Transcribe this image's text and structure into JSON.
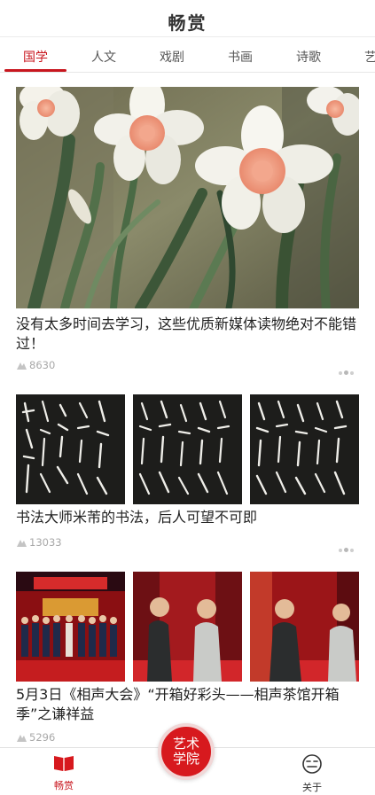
{
  "header": {
    "title": "畅赏"
  },
  "tabs": [
    {
      "label": "国学",
      "active": true
    },
    {
      "label": "人文",
      "active": false
    },
    {
      "label": "戏剧",
      "active": false
    },
    {
      "label": "书画",
      "active": false
    },
    {
      "label": "诗歌",
      "active": false
    },
    {
      "label": "艺",
      "active": false
    }
  ],
  "feed": {
    "articles": [
      {
        "title": "没有太多时间去学习，这些优质新媒体读物绝对不能错过！",
        "views": "8630",
        "image": "daffodil-painting"
      },
      {
        "title": "书法大师米芾的书法，后人可望不可即",
        "views": "13033",
        "image": "calligraphy-panels"
      },
      {
        "title": "5月3日《相声大会》“开箱好彩头——相声茶馆开箱季”之谦祥益",
        "views": "5296",
        "image": "crosstalk-stage"
      }
    ]
  },
  "bottom_nav": {
    "items": [
      {
        "label": "畅赏",
        "icon": "book-icon",
        "active": true
      },
      {
        "label": "关于",
        "icon": "face-icon",
        "active": false
      }
    ],
    "center_button": {
      "line1": "艺术",
      "line2": "学院"
    }
  },
  "colors": {
    "accent": "#c8161e",
    "muted": "#a8a8a8",
    "text": "#222222"
  }
}
